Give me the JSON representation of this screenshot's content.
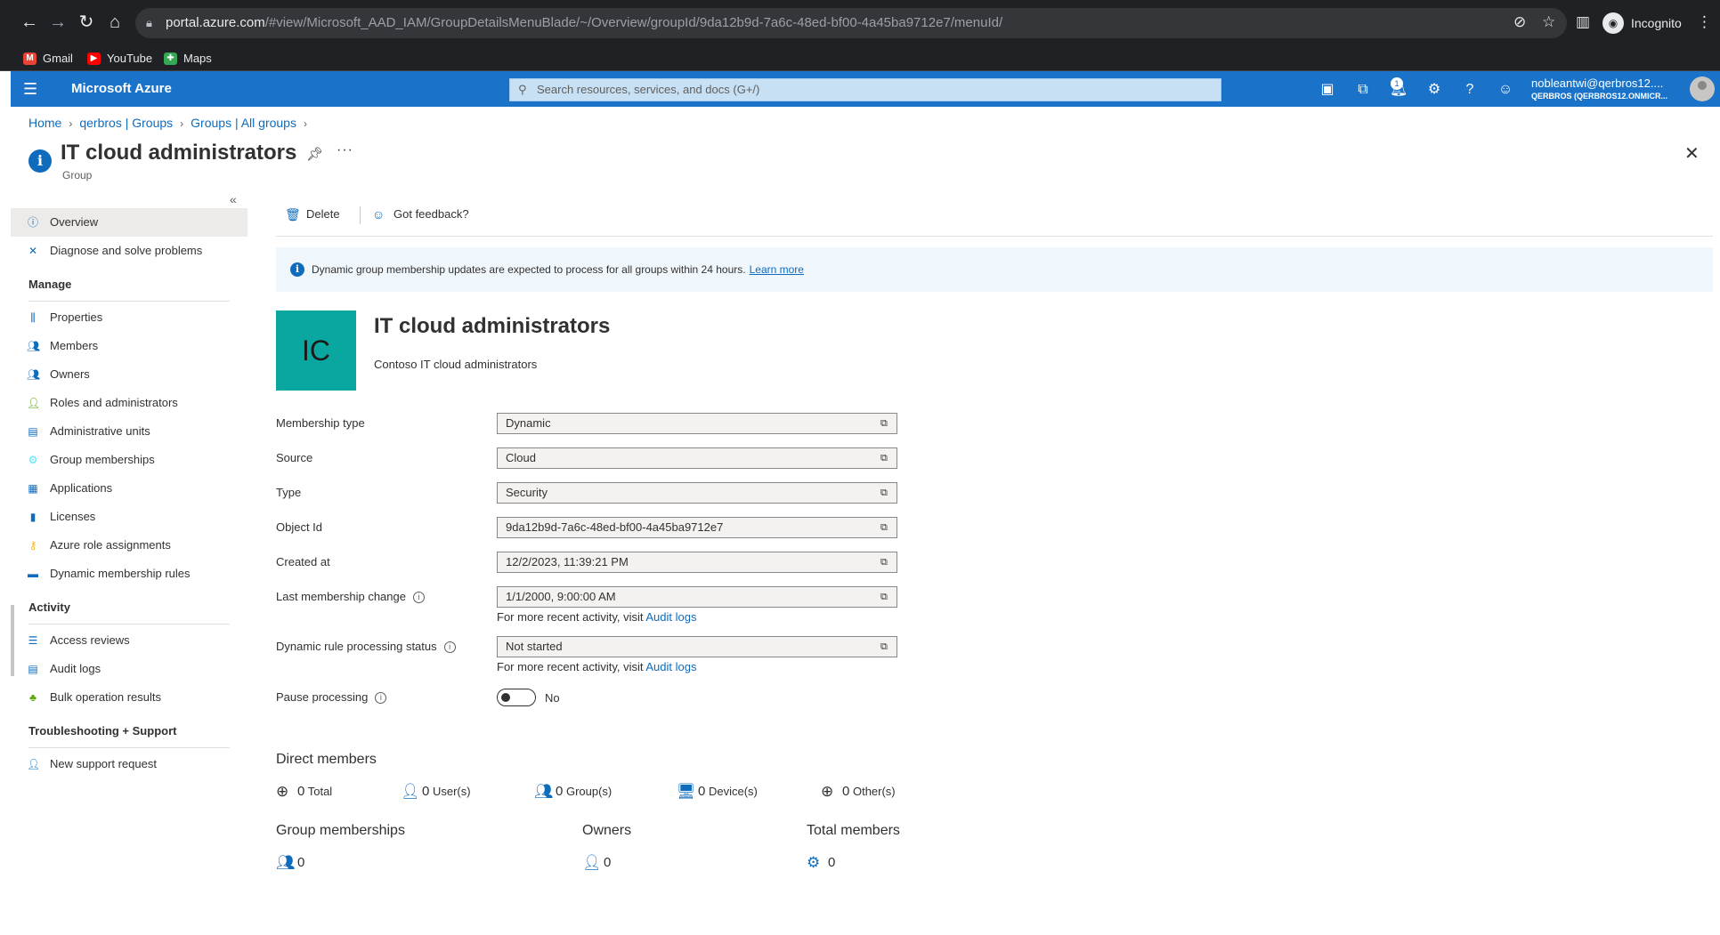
{
  "browser": {
    "url_host": "portal.azure.com",
    "url_path": "/#view/Microsoft_AAD_IAM/GroupDetailsMenuBlade/~/Overview/groupId/9da12b9d-7a6c-48ed-bf00-4a45ba9712e7/menuId/",
    "incognito_label": "Incognito",
    "bookmarks": [
      {
        "label": "Gmail",
        "icon": "gmail-icon",
        "color": "#ea4335"
      },
      {
        "label": "YouTube",
        "icon": "youtube-icon",
        "color": "#ff0000"
      },
      {
        "label": "Maps",
        "icon": "maps-icon",
        "color": "#34a853"
      }
    ]
  },
  "portal": {
    "brand": "Microsoft Azure",
    "search_placeholder": "Search resources, services, and docs (G+/)",
    "notification_count": "1",
    "user_name": "nobleantwi@qerbros12....",
    "user_tenant": "QERBROS (QERBROS12.ONMICR...",
    "accent": "#1a73c9"
  },
  "breadcrumb": [
    "Home",
    "qerbros | Groups",
    "Groups | All groups"
  ],
  "blade": {
    "title": "IT cloud administrators",
    "subtitle": "Group"
  },
  "sidebar": {
    "items_top": [
      {
        "label": "Overview",
        "icon": "info-icon"
      },
      {
        "label": "Diagnose and solve problems",
        "icon": "wrench-icon"
      }
    ],
    "manage_heading": "Manage",
    "manage": [
      {
        "label": "Properties",
        "icon": "properties-icon"
      },
      {
        "label": "Members",
        "icon": "members-icon"
      },
      {
        "label": "Owners",
        "icon": "owners-icon"
      },
      {
        "label": "Roles and administrators",
        "icon": "roles-icon"
      },
      {
        "label": "Administrative units",
        "icon": "admin-units-icon"
      },
      {
        "label": "Group memberships",
        "icon": "gear-icon"
      },
      {
        "label": "Applications",
        "icon": "apps-grid-icon"
      },
      {
        "label": "Licenses",
        "icon": "licenses-icon"
      },
      {
        "label": "Azure role assignments",
        "icon": "key-icon"
      },
      {
        "label": "Dynamic membership rules",
        "icon": "rules-icon"
      }
    ],
    "activity_heading": "Activity",
    "activity": [
      {
        "label": "Access reviews",
        "icon": "list-icon"
      },
      {
        "label": "Audit logs",
        "icon": "log-icon"
      },
      {
        "label": "Bulk operation results",
        "icon": "bulk-icon"
      }
    ],
    "support_heading": "Troubleshooting + Support",
    "support": [
      {
        "label": "New support request",
        "icon": "support-icon"
      }
    ]
  },
  "commands": {
    "delete": "Delete",
    "feedback": "Got feedback?"
  },
  "info_banner": {
    "text": "Dynamic group membership updates are expected to process for all groups within 24 hours.",
    "link": "Learn more"
  },
  "group": {
    "initials": "IC",
    "tile_color": "#0aa7a1",
    "name": "IT cloud administrators",
    "description": "Contoso IT cloud administrators"
  },
  "properties": {
    "membership_type": {
      "label": "Membership type",
      "value": "Dynamic"
    },
    "source": {
      "label": "Source",
      "value": "Cloud"
    },
    "type": {
      "label": "Type",
      "value": "Security"
    },
    "object_id": {
      "label": "Object Id",
      "value": "9da12b9d-7a6c-48ed-bf00-4a45ba9712e7"
    },
    "created_at": {
      "label": "Created at",
      "value": "12/2/2023, 11:39:21 PM"
    },
    "last_membership_change": {
      "label": "Last membership change",
      "value": "1/1/2000, 9:00:00 AM"
    },
    "dynamic_rule_status": {
      "label": "Dynamic rule processing status",
      "value": "Not started"
    },
    "note_prefix": "For more recent activity, visit",
    "note_link": "Audit logs",
    "pause_processing": {
      "label": "Pause processing",
      "value": "No"
    }
  },
  "direct_members": {
    "heading": "Direct members",
    "total": {
      "count": "0",
      "label": "Total"
    },
    "users": {
      "count": "0",
      "label": "User(s)"
    },
    "groups": {
      "count": "0",
      "label": "Group(s)"
    },
    "devices": {
      "count": "0",
      "label": "Device(s)"
    },
    "others": {
      "count": "0",
      "label": "Other(s)"
    }
  },
  "summary": {
    "group_memberships": {
      "label": "Group memberships",
      "count": "0"
    },
    "owners": {
      "label": "Owners",
      "count": "0"
    },
    "total_members": {
      "label": "Total members",
      "count": "0"
    }
  }
}
